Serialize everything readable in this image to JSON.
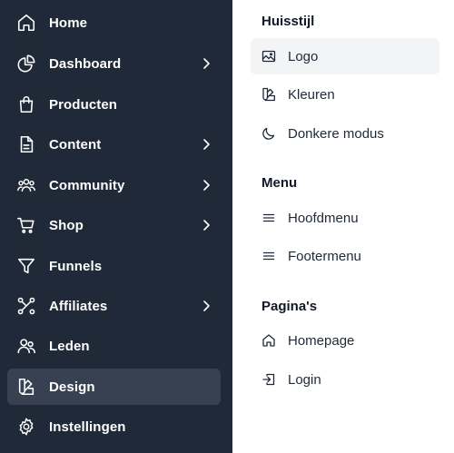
{
  "sidebar": {
    "items": [
      {
        "label": "Home",
        "icon": "home-icon"
      },
      {
        "label": "Dashboard",
        "icon": "pie-chart-icon",
        "has_submenu": true
      },
      {
        "label": "Producten",
        "icon": "shopping-bag-icon"
      },
      {
        "label": "Content",
        "icon": "document-icon",
        "has_submenu": true
      },
      {
        "label": "Community",
        "icon": "users-group-icon",
        "has_submenu": true
      },
      {
        "label": "Shop",
        "icon": "shopping-cart-icon",
        "has_submenu": true
      },
      {
        "label": "Funnels",
        "icon": "funnel-icon"
      },
      {
        "label": "Affiliates",
        "icon": "share-icon",
        "has_submenu": true
      },
      {
        "label": "Leden",
        "icon": "user-group-icon"
      },
      {
        "label": "Design",
        "icon": "swatch-icon",
        "active": true
      },
      {
        "label": "Instellingen",
        "icon": "gear-icon"
      }
    ]
  },
  "design_menu": {
    "sections": [
      {
        "title": "Huisstijl",
        "items": [
          {
            "label": "Logo",
            "icon": "image-icon",
            "active": true
          },
          {
            "label": "Kleuren",
            "icon": "swatch-icon"
          },
          {
            "label": "Donkere modus",
            "icon": "moon-icon"
          }
        ]
      },
      {
        "title": "Menu",
        "items": [
          {
            "label": "Hoofdmenu",
            "icon": "menu-lines-icon"
          },
          {
            "label": "Footermenu",
            "icon": "menu-lines-icon"
          }
        ]
      },
      {
        "title": "Pagina's",
        "items": [
          {
            "label": "Homepage",
            "icon": "home-icon"
          },
          {
            "label": "Login",
            "icon": "login-icon"
          }
        ]
      }
    ]
  },
  "colors": {
    "sidebar_bg": "#1f2937",
    "sidebar_active_bg": "#374151",
    "panel_bg": "#ffffff",
    "panel_active_bg": "#f3f4f6"
  }
}
